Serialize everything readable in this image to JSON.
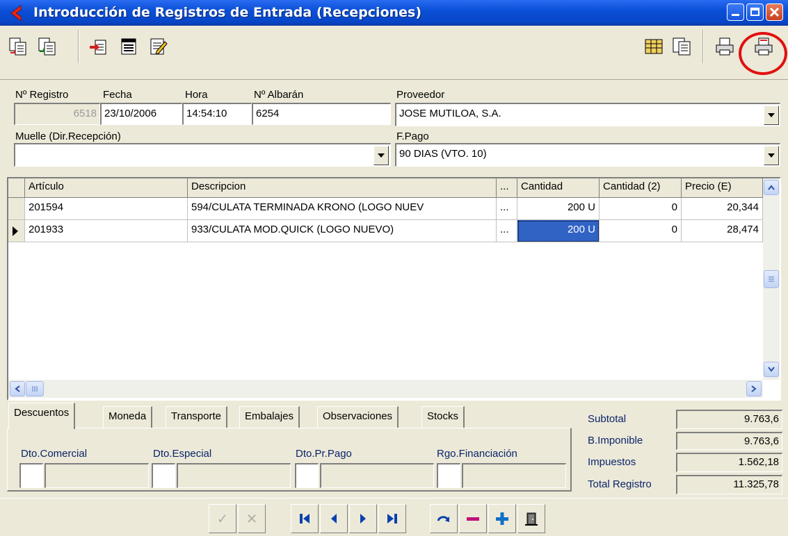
{
  "window": {
    "title": "Introducción de Registros de Entrada (Recepciones)"
  },
  "toolbar": {
    "left_icons": [
      "copy-document-icon",
      "copy-document-green-icon",
      "new-document-icon",
      "list-document-icon",
      "edit-document-icon"
    ],
    "right_icons": [
      "report-icon",
      "copy-report-icon",
      "print-icon",
      "print-label-icon"
    ]
  },
  "form": {
    "registro": {
      "label": "Nº Registro",
      "value": "6518"
    },
    "fecha": {
      "label": "Fecha",
      "value": "23/10/2006"
    },
    "hora": {
      "label": "Hora",
      "value": "14:54:10"
    },
    "albaran": {
      "label": "Nº Albarán",
      "value": "6254"
    },
    "proveedor": {
      "label": "Proveedor",
      "value": "JOSE MUTILOA, S.A."
    },
    "muelle": {
      "label": "Muelle (Dir.Recepción)",
      "value": ""
    },
    "fpago": {
      "label": "F.Pago",
      "value": "90 DIAS (VTO. 10)"
    }
  },
  "grid": {
    "headers": {
      "articulo": "Artículo",
      "descripcion": "Descripcion",
      "dots": "...",
      "cantidad": "Cantidad",
      "cantidad2": "Cantidad (2)",
      "precio": "Precio (E)"
    },
    "rows": [
      {
        "articulo": "201594",
        "descripcion": "594/CULATA TERMINADA KRONO (LOGO NUEV",
        "dots": "...",
        "cantidad": "200",
        "unit": "U",
        "cantidad2": "0",
        "precio": "20,344"
      },
      {
        "articulo": "201933",
        "descripcion": "933/CULATA MOD.QUICK  (LOGO NUEVO)",
        "dots": "...",
        "cantidad": "200",
        "unit": "U",
        "cantidad2": "0",
        "precio": "28,474"
      }
    ]
  },
  "tabs": [
    "Descuentos",
    "Moneda",
    "Transporte",
    "Embalajes",
    "Observaciones",
    "Stocks"
  ],
  "discounts": {
    "comercial": "Dto.Comercial",
    "especial": "Dto.Especial",
    "prpago": "Dto.Pr.Pago",
    "financiacion": "Rgo.Financiación"
  },
  "totals": {
    "subtotal": {
      "label": "Subtotal",
      "value": "9.763,6"
    },
    "imponible": {
      "label": "B.Imponible",
      "value": "9.763,6"
    },
    "impuestos": {
      "label": "Impuestos",
      "value": "1.562,18"
    },
    "total": {
      "label": "Total Registro",
      "value": "11.325,78"
    }
  },
  "nav": {
    "glyphs": {
      "ok": "✓",
      "cancel": "✕"
    }
  },
  "colors": {
    "titlebar": "#0a4fd8",
    "selection": "#3163c5",
    "highlight_circle": "#e01010",
    "face": "#ece9d8"
  }
}
